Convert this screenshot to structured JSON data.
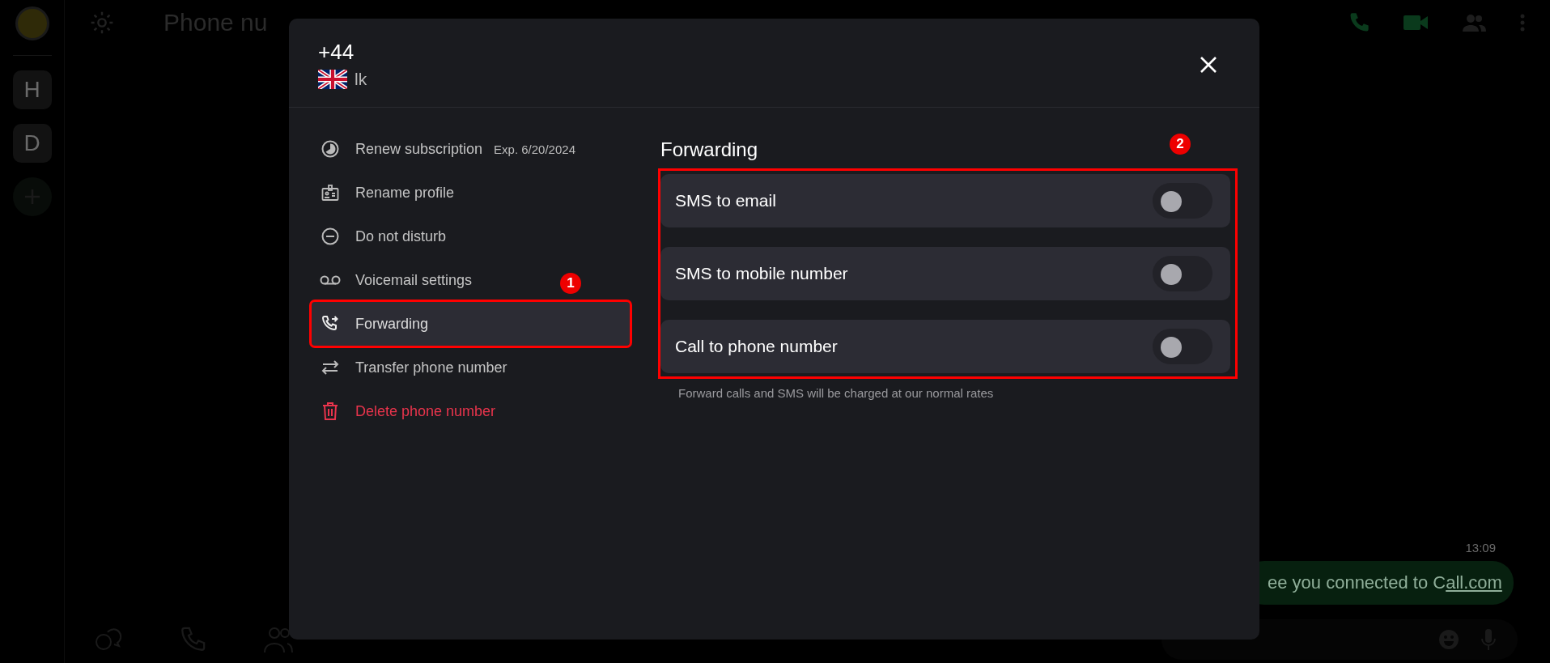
{
  "rail": {
    "items": [
      {
        "label": "H"
      },
      {
        "label": "D"
      }
    ]
  },
  "top_bar": {
    "title": "Phone nu"
  },
  "chat": {
    "time": "13:09",
    "message": {
      "text": "ee you connected to C",
      "link": "all.com"
    }
  },
  "dialog": {
    "number": "+44",
    "country_label": "lk",
    "menu": [
      {
        "kind": "renew",
        "label": "Renew subscription",
        "note": "Exp. 6/20/2024",
        "selected": false,
        "danger": false
      },
      {
        "kind": "rename",
        "label": "Rename profile",
        "selected": false,
        "danger": false
      },
      {
        "kind": "dnd",
        "label": "Do not disturb",
        "selected": false,
        "danger": false
      },
      {
        "kind": "voicemail",
        "label": "Voicemail settings",
        "selected": false,
        "danger": false
      },
      {
        "kind": "forward",
        "label": "Forwarding",
        "selected": true,
        "danger": false,
        "badge": "1"
      },
      {
        "kind": "transfer",
        "label": "Transfer phone number",
        "selected": false,
        "danger": false
      },
      {
        "kind": "delete",
        "label": "Delete phone number",
        "selected": false,
        "danger": true
      }
    ],
    "section_title": "Forwarding",
    "toggles": [
      {
        "label": "SMS to email",
        "on": false
      },
      {
        "label": "SMS to mobile number",
        "on": false
      },
      {
        "label": "Call to phone number",
        "on": false
      }
    ],
    "toggles_badge": "2",
    "note": "Forward calls and SMS will be charged at our normal rates"
  }
}
